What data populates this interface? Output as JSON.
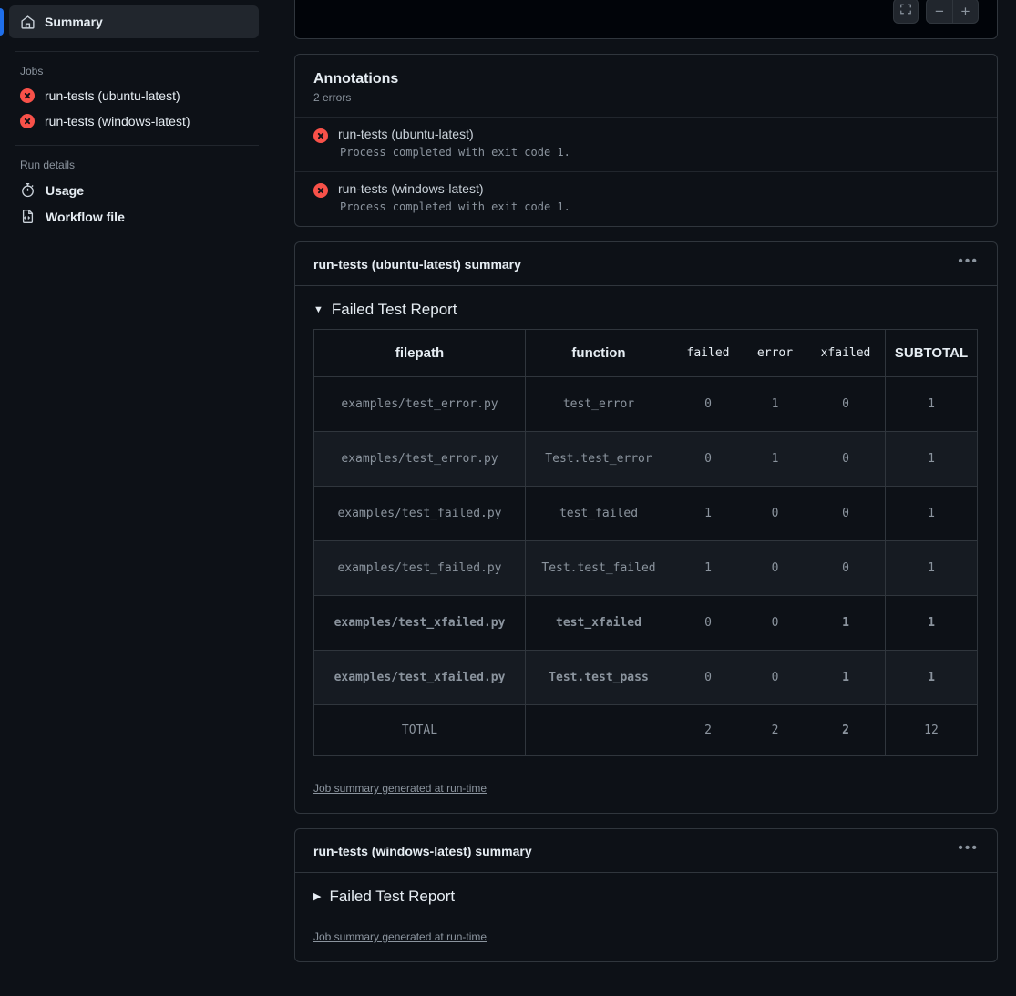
{
  "sidebar": {
    "active_item": {
      "label": "Summary",
      "icon": "home-icon"
    },
    "jobs_section_title": "Jobs",
    "jobs": [
      {
        "label": "run-tests (ubuntu-latest)",
        "status": "error"
      },
      {
        "label": "run-tests (windows-latest)",
        "status": "error"
      }
    ],
    "run_details_title": "Run details",
    "run_details": [
      {
        "label": "Usage",
        "icon": "stopwatch-icon"
      },
      {
        "label": "Workflow file",
        "icon": "file-code-icon"
      }
    ]
  },
  "top_panel": {
    "fullscreen_label": "fullscreen-icon",
    "zoom_out_label": "−",
    "zoom_in_label": "+"
  },
  "annotations": {
    "title": "Annotations",
    "subtitle": "2 errors",
    "items": [
      {
        "name": "run-tests (ubuntu-latest)",
        "message": "Process completed with exit code 1."
      },
      {
        "name": "run-tests (windows-latest)",
        "message": "Process completed with exit code 1."
      }
    ]
  },
  "summaries": [
    {
      "title": "run-tests (ubuntu-latest) summary",
      "menu_label": "•••",
      "report_title": "Failed Test Report",
      "expanded": true,
      "disclosure_glyph": "▼",
      "runtime_note": "Job summary generated at run-time"
    },
    {
      "title": "run-tests (windows-latest) summary",
      "menu_label": "•••",
      "report_title": "Failed Test Report",
      "expanded": false,
      "disclosure_glyph": "▶",
      "runtime_note": "Job summary generated at run-time"
    }
  ],
  "chart_data": {
    "type": "table",
    "title": "Failed Test Report",
    "columns": [
      "filepath",
      "function",
      "failed",
      "error",
      "xfailed",
      "SUBTOTAL"
    ],
    "column_styles": [
      "plain",
      "plain",
      "red-mono",
      "red-mono",
      "yellow-mono",
      "plain"
    ],
    "rows": [
      {
        "filepath": "examples/test_error.py",
        "function": "test_error",
        "failed": "0",
        "error": "1",
        "xfailed": "0",
        "subtotal": "1",
        "style": "red"
      },
      {
        "filepath": "examples/test_error.py",
        "function": "Test.test_error",
        "failed": "0",
        "error": "1",
        "xfailed": "0",
        "subtotal": "1",
        "style": "red"
      },
      {
        "filepath": "examples/test_failed.py",
        "function": "test_failed",
        "failed": "1",
        "error": "0",
        "xfailed": "0",
        "subtotal": "1",
        "style": "red"
      },
      {
        "filepath": "examples/test_failed.py",
        "function": "Test.test_failed",
        "failed": "1",
        "error": "0",
        "xfailed": "0",
        "subtotal": "1",
        "style": "red"
      },
      {
        "filepath": "examples/test_xfailed.py",
        "function": "test_xfailed",
        "failed": "0",
        "error": "0",
        "xfailed": "1",
        "subtotal": "1",
        "style": "yellow"
      },
      {
        "filepath": "examples/test_xfailed.py",
        "function": "Test.test_pass",
        "failed": "0",
        "error": "0",
        "xfailed": "1",
        "subtotal": "1",
        "style": "yellow"
      }
    ],
    "total_row": {
      "label": "TOTAL",
      "function": "",
      "failed": "2",
      "error": "2",
      "xfailed": "2",
      "subtotal": "12"
    },
    "colors": {
      "red": "#f85149",
      "yellow": "#e3e300",
      "dim": "#6e7681"
    }
  }
}
